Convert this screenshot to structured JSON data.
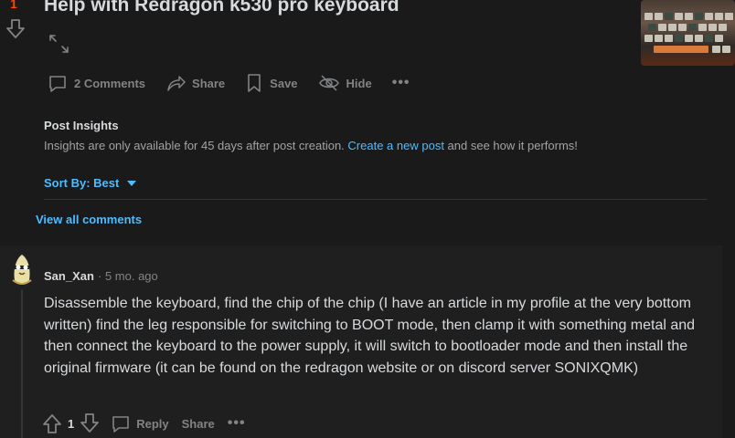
{
  "post": {
    "vote_count": "1",
    "title": "Help with Redragon k530 pro keyboard",
    "actions": {
      "comments": "2 Comments",
      "share": "Share",
      "save": "Save",
      "hide": "Hide",
      "more": "•••"
    }
  },
  "insights": {
    "title": "Post Insights",
    "text_before": "Insights are only available for 45 days after post creation. ",
    "link": "Create a new post",
    "text_after": " and see how it performs!"
  },
  "sort": {
    "label": "Sort By: Best"
  },
  "view_all": "View all comments",
  "comment": {
    "author": "San_Xan",
    "meta": "· 5 mo. ago",
    "body": "Disassemble the keyboard, find the chip of the chip (I have an article in my profile at the very bottom written) find the leg responsible for switching to BOOT mode, then clamp it with something metal and then connect the keyboard to the power supply, it will switch to bootloader mode and then install the original firmware (it can be found on the redragon website or on discord server SONIXQMK)",
    "score": "1",
    "reply": "Reply",
    "share": "Share",
    "more": "•••"
  },
  "colors": {
    "accent": "#4fbcff",
    "upvote": "#ff4500",
    "background": "#1a1a1b"
  },
  "icons": [
    "downvote-icon",
    "expand-icon",
    "comment-icon",
    "share-icon",
    "save-icon",
    "hide-icon",
    "more-icon",
    "upvote-icon",
    "reply-icon"
  ]
}
